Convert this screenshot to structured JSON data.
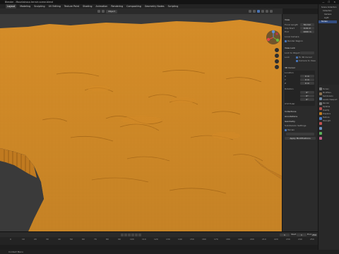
{
  "app": {
    "title": "Blender - Mountainous terrain scene.blend",
    "window_controls": "— ☐ ✕"
  },
  "menubar": {
    "workspaces": [
      "Layout",
      "Modeling",
      "Sculpting",
      "UV Editing",
      "Texture Paint",
      "Shading",
      "Animation",
      "Rendering",
      "Compositing",
      "Geometry Nodes",
      "Scripting"
    ],
    "active_workspace": "Layout",
    "scene_name": "Scene"
  },
  "viewport_header": {
    "interaction_mode": "Object"
  },
  "npanel": {
    "view_section": "View",
    "focal_length_label": "Focal Length",
    "focal_length_value": "50 mm",
    "clip_start_label": "Clip Start",
    "clip_start_value": "0.01 m",
    "clip_end_label": "End",
    "clip_end_value": "1000 m",
    "local_camera_label": "Local Camera",
    "render_region_label": "Render Region",
    "view_lock_section": "View Lock",
    "lock_to_object_label": "Lock to Object",
    "lock_label": "Lock",
    "to_3d_cursor_label": "To 3D Cursor",
    "camera_to_view_label": "Camera to View",
    "cursor_section": "3D Cursor",
    "location_label": "Location",
    "x_label": "X",
    "x_value": "0 m",
    "y_label": "Y",
    "y_value": "0 m",
    "z_label": "Z",
    "z_value": "0 m",
    "rotation_label": "Rotation",
    "rx_value": "0°",
    "ry_value": "0°",
    "rz_value": "0°",
    "rotation_mode": "XYZ Euler",
    "collections_section": "Collections",
    "annotations_section": "Annotations",
    "geometry_section": "Geometry",
    "sub_label": "Subdivision Settings",
    "feature_label": "Terrain",
    "apply_button": "Apply Modifications"
  },
  "outliner": {
    "items": [
      "Scene Collection",
      "Collection",
      "Camera",
      "Light",
      "Terrain"
    ]
  },
  "properties": {
    "rows": [
      "Terrain",
      "Modifiers",
      "Subdivision",
      "Levels Viewport",
      "Render",
      "Optimal",
      "Quality",
      "Displace",
      "Texture",
      "Strength"
    ]
  },
  "timeline": {
    "current_frame": "1",
    "start_label": "Start",
    "start_frame": "1",
    "end_label": "End",
    "end_frame": "250",
    "ruler_labels": [
      "0",
      "10",
      "20",
      "30",
      "40",
      "50",
      "60",
      "70",
      "80",
      "90",
      "100",
      "110",
      "120",
      "130",
      "140",
      "150",
      "160",
      "170",
      "180",
      "190",
      "200",
      "210",
      "220",
      "230",
      "240",
      "250"
    ]
  },
  "status_bar": {
    "text": "Context Menu"
  },
  "colors": {
    "terrain": "#e89a2d",
    "background": "#3a3a3a",
    "accent": "#4772b3"
  }
}
